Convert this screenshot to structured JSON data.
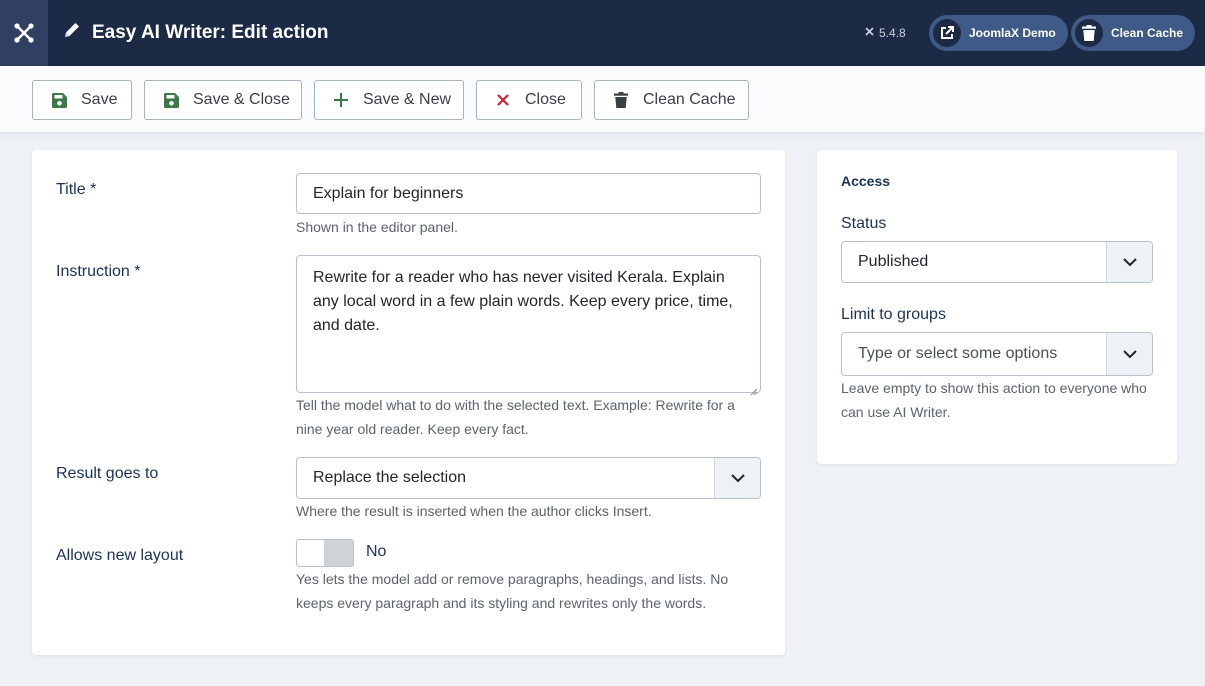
{
  "header": {
    "title": "Easy AI Writer: Edit action",
    "version": "5.4.8",
    "demo_button": "JoomlaX Demo",
    "cache_button": "Clean Cache"
  },
  "toolbar": {
    "save": "Save",
    "save_close": "Save & Close",
    "save_new": "Save & New",
    "close": "Close",
    "clean_cache": "Clean Cache"
  },
  "form": {
    "title_label": "Title *",
    "title_value": "Explain for beginners",
    "title_help": "Shown in the editor panel.",
    "instruction_label": "Instruction *",
    "instruction_value": "Rewrite for a reader who has never visited Kerala. Explain any local word in a few plain words. Keep every price, time, and date.",
    "instruction_help": "Tell the model what to do with the selected text. Example: Rewrite for a nine year old reader. Keep every fact.",
    "result_label": "Result goes to",
    "result_value": "Replace the selection",
    "result_help": "Where the result is inserted when the author clicks Insert.",
    "layout_label": "Allows new layout",
    "layout_value": "No",
    "layout_help": "Yes lets the model add or remove paragraphs, headings, and lists. No keeps every paragraph and its styling and rewrites only the words."
  },
  "access": {
    "heading": "Access",
    "status_label": "Status",
    "status_value": "Published",
    "groups_label": "Limit to groups",
    "groups_placeholder": "Type or select some options",
    "groups_help": "Leave empty to show this action to everyone who can use AI Writer."
  },
  "colors": {
    "header_bg": "#1c2a45",
    "header_button": "#3f5a86",
    "label_blue": "#1b3257",
    "save_green": "#3d7a4a",
    "close_red": "#c5262b"
  },
  "icons": [
    "joomla-logo-icon",
    "pencil-icon",
    "joomla-small-icon",
    "external-link-icon",
    "trash-icon",
    "save-icon",
    "plus-icon",
    "close-icon",
    "chevron-down-icon"
  ]
}
